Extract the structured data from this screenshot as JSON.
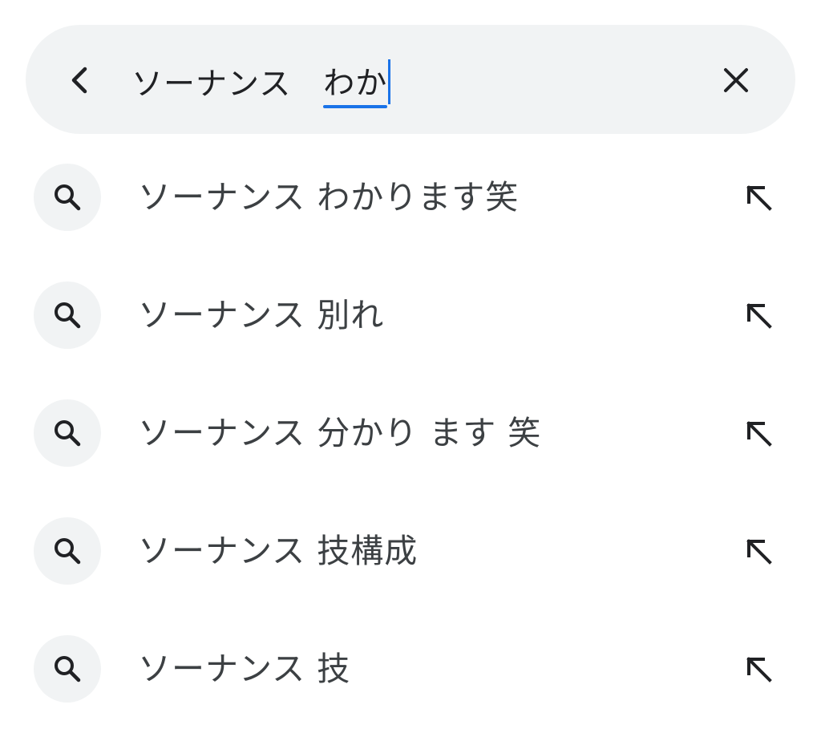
{
  "search": {
    "query_committed": "ソーナンス　",
    "query_composing": "わか",
    "back_icon": "chevron-left-icon",
    "clear_icon": "close-icon"
  },
  "suggestions": [
    {
      "text": "ソーナンス わかります笑",
      "icon": "search-icon",
      "action_icon": "arrow-up-left-icon"
    },
    {
      "text": "ソーナンス 別れ",
      "icon": "search-icon",
      "action_icon": "arrow-up-left-icon"
    },
    {
      "text": "ソーナンス 分かり ます 笑",
      "icon": "search-icon",
      "action_icon": "arrow-up-left-icon"
    },
    {
      "text": "ソーナンス 技構成",
      "icon": "search-icon",
      "action_icon": "arrow-up-left-icon"
    },
    {
      "text": "ソーナンス 技",
      "icon": "search-icon",
      "action_icon": "arrow-up-left-icon"
    }
  ],
  "colors": {
    "bar_bg": "#f1f3f4",
    "accent": "#1a73e8",
    "text": "#3c4043"
  }
}
